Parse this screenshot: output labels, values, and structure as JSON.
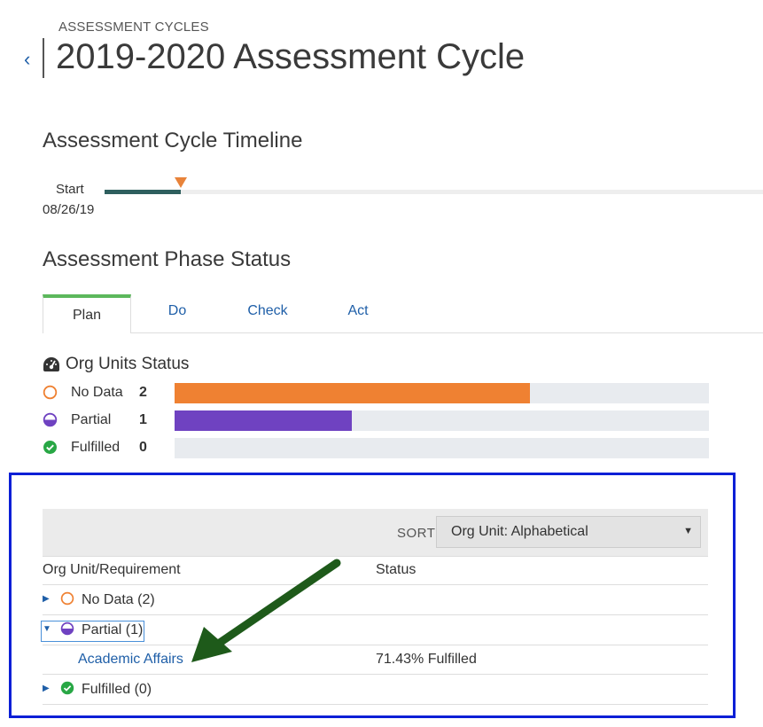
{
  "header": {
    "breadcrumb": "ASSESSMENT CYCLES",
    "title": "2019-2020 Assessment Cycle",
    "back_icon": "chevron-left-icon"
  },
  "timeline": {
    "title": "Assessment Cycle Timeline",
    "start_label": "Start",
    "start_date": "08/26/19",
    "progress_fraction": 0.116,
    "marker_color": "#e8833a",
    "progress_color": "#2e5f5e"
  },
  "phase_status": {
    "title": "Assessment Phase Status",
    "tabs": [
      {
        "label": "Plan",
        "active": true
      },
      {
        "label": "Do",
        "active": false
      },
      {
        "label": "Check",
        "active": false
      },
      {
        "label": "Act",
        "active": false
      }
    ],
    "active_tab_color": "#5cb85c"
  },
  "org_units_status": {
    "title": "Org Units Status",
    "icon": "dashboard-gauge-icon",
    "rows": [
      {
        "label": "No Data",
        "count": "2",
        "fraction": 0.665,
        "color": "#ef8132",
        "icon": "empty-circle-icon"
      },
      {
        "label": "Partial",
        "count": "1",
        "fraction": 0.332,
        "color": "#6f42c1",
        "icon": "half-circle-icon"
      },
      {
        "label": "Fulfilled",
        "count": "0",
        "fraction": 0,
        "color": "#28a745",
        "icon": "check-circle-icon"
      }
    ]
  },
  "org_table": {
    "sort_label": "SORT",
    "sort_value": "Org Unit: Alphabetical",
    "col_unit": "Org Unit/Requirement",
    "col_status": "Status",
    "groups": [
      {
        "label": "No Data (2)",
        "expanded": false,
        "icon": "empty-circle-icon"
      },
      {
        "label": "Partial (1)",
        "expanded": true,
        "icon": "half-circle-icon"
      },
      {
        "label": "Fulfilled (0)",
        "expanded": false,
        "icon": "check-circle-icon"
      }
    ],
    "child": {
      "name": "Academic Affairs",
      "status": "71.43% Fulfilled"
    }
  },
  "annotation": {
    "box_color": "#0b1fd6",
    "arrow_color": "#1e5a1a"
  }
}
